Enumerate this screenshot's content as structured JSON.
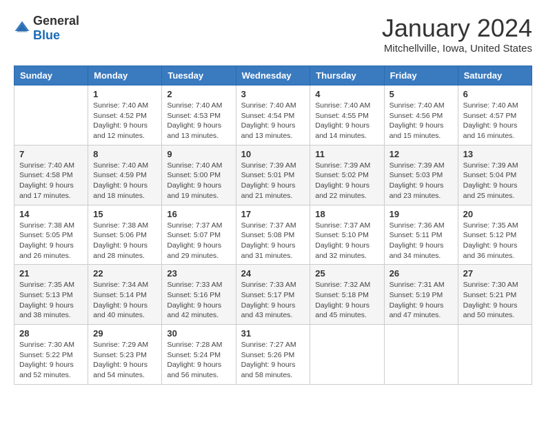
{
  "logo": {
    "general": "General",
    "blue": "Blue"
  },
  "title": "January 2024",
  "location": "Mitchellville, Iowa, United States",
  "days_of_week": [
    "Sunday",
    "Monday",
    "Tuesday",
    "Wednesday",
    "Thursday",
    "Friday",
    "Saturday"
  ],
  "weeks": [
    [
      {
        "day": "",
        "info": ""
      },
      {
        "day": "1",
        "info": "Sunrise: 7:40 AM\nSunset: 4:52 PM\nDaylight: 9 hours and 12 minutes."
      },
      {
        "day": "2",
        "info": "Sunrise: 7:40 AM\nSunset: 4:53 PM\nDaylight: 9 hours and 13 minutes."
      },
      {
        "day": "3",
        "info": "Sunrise: 7:40 AM\nSunset: 4:54 PM\nDaylight: 9 hours and 13 minutes."
      },
      {
        "day": "4",
        "info": "Sunrise: 7:40 AM\nSunset: 4:55 PM\nDaylight: 9 hours and 14 minutes."
      },
      {
        "day": "5",
        "info": "Sunrise: 7:40 AM\nSunset: 4:56 PM\nDaylight: 9 hours and 15 minutes."
      },
      {
        "day": "6",
        "info": "Sunrise: 7:40 AM\nSunset: 4:57 PM\nDaylight: 9 hours and 16 minutes."
      }
    ],
    [
      {
        "day": "7",
        "info": "Sunrise: 7:40 AM\nSunset: 4:58 PM\nDaylight: 9 hours and 17 minutes."
      },
      {
        "day": "8",
        "info": "Sunrise: 7:40 AM\nSunset: 4:59 PM\nDaylight: 9 hours and 18 minutes."
      },
      {
        "day": "9",
        "info": "Sunrise: 7:40 AM\nSunset: 5:00 PM\nDaylight: 9 hours and 19 minutes."
      },
      {
        "day": "10",
        "info": "Sunrise: 7:39 AM\nSunset: 5:01 PM\nDaylight: 9 hours and 21 minutes."
      },
      {
        "day": "11",
        "info": "Sunrise: 7:39 AM\nSunset: 5:02 PM\nDaylight: 9 hours and 22 minutes."
      },
      {
        "day": "12",
        "info": "Sunrise: 7:39 AM\nSunset: 5:03 PM\nDaylight: 9 hours and 23 minutes."
      },
      {
        "day": "13",
        "info": "Sunrise: 7:39 AM\nSunset: 5:04 PM\nDaylight: 9 hours and 25 minutes."
      }
    ],
    [
      {
        "day": "14",
        "info": "Sunrise: 7:38 AM\nSunset: 5:05 PM\nDaylight: 9 hours and 26 minutes."
      },
      {
        "day": "15",
        "info": "Sunrise: 7:38 AM\nSunset: 5:06 PM\nDaylight: 9 hours and 28 minutes."
      },
      {
        "day": "16",
        "info": "Sunrise: 7:37 AM\nSunset: 5:07 PM\nDaylight: 9 hours and 29 minutes."
      },
      {
        "day": "17",
        "info": "Sunrise: 7:37 AM\nSunset: 5:08 PM\nDaylight: 9 hours and 31 minutes."
      },
      {
        "day": "18",
        "info": "Sunrise: 7:37 AM\nSunset: 5:10 PM\nDaylight: 9 hours and 32 minutes."
      },
      {
        "day": "19",
        "info": "Sunrise: 7:36 AM\nSunset: 5:11 PM\nDaylight: 9 hours and 34 minutes."
      },
      {
        "day": "20",
        "info": "Sunrise: 7:35 AM\nSunset: 5:12 PM\nDaylight: 9 hours and 36 minutes."
      }
    ],
    [
      {
        "day": "21",
        "info": "Sunrise: 7:35 AM\nSunset: 5:13 PM\nDaylight: 9 hours and 38 minutes."
      },
      {
        "day": "22",
        "info": "Sunrise: 7:34 AM\nSunset: 5:14 PM\nDaylight: 9 hours and 40 minutes."
      },
      {
        "day": "23",
        "info": "Sunrise: 7:33 AM\nSunset: 5:16 PM\nDaylight: 9 hours and 42 minutes."
      },
      {
        "day": "24",
        "info": "Sunrise: 7:33 AM\nSunset: 5:17 PM\nDaylight: 9 hours and 43 minutes."
      },
      {
        "day": "25",
        "info": "Sunrise: 7:32 AM\nSunset: 5:18 PM\nDaylight: 9 hours and 45 minutes."
      },
      {
        "day": "26",
        "info": "Sunrise: 7:31 AM\nSunset: 5:19 PM\nDaylight: 9 hours and 47 minutes."
      },
      {
        "day": "27",
        "info": "Sunrise: 7:30 AM\nSunset: 5:21 PM\nDaylight: 9 hours and 50 minutes."
      }
    ],
    [
      {
        "day": "28",
        "info": "Sunrise: 7:30 AM\nSunset: 5:22 PM\nDaylight: 9 hours and 52 minutes."
      },
      {
        "day": "29",
        "info": "Sunrise: 7:29 AM\nSunset: 5:23 PM\nDaylight: 9 hours and 54 minutes."
      },
      {
        "day": "30",
        "info": "Sunrise: 7:28 AM\nSunset: 5:24 PM\nDaylight: 9 hours and 56 minutes."
      },
      {
        "day": "31",
        "info": "Sunrise: 7:27 AM\nSunset: 5:26 PM\nDaylight: 9 hours and 58 minutes."
      },
      {
        "day": "",
        "info": ""
      },
      {
        "day": "",
        "info": ""
      },
      {
        "day": "",
        "info": ""
      }
    ]
  ]
}
